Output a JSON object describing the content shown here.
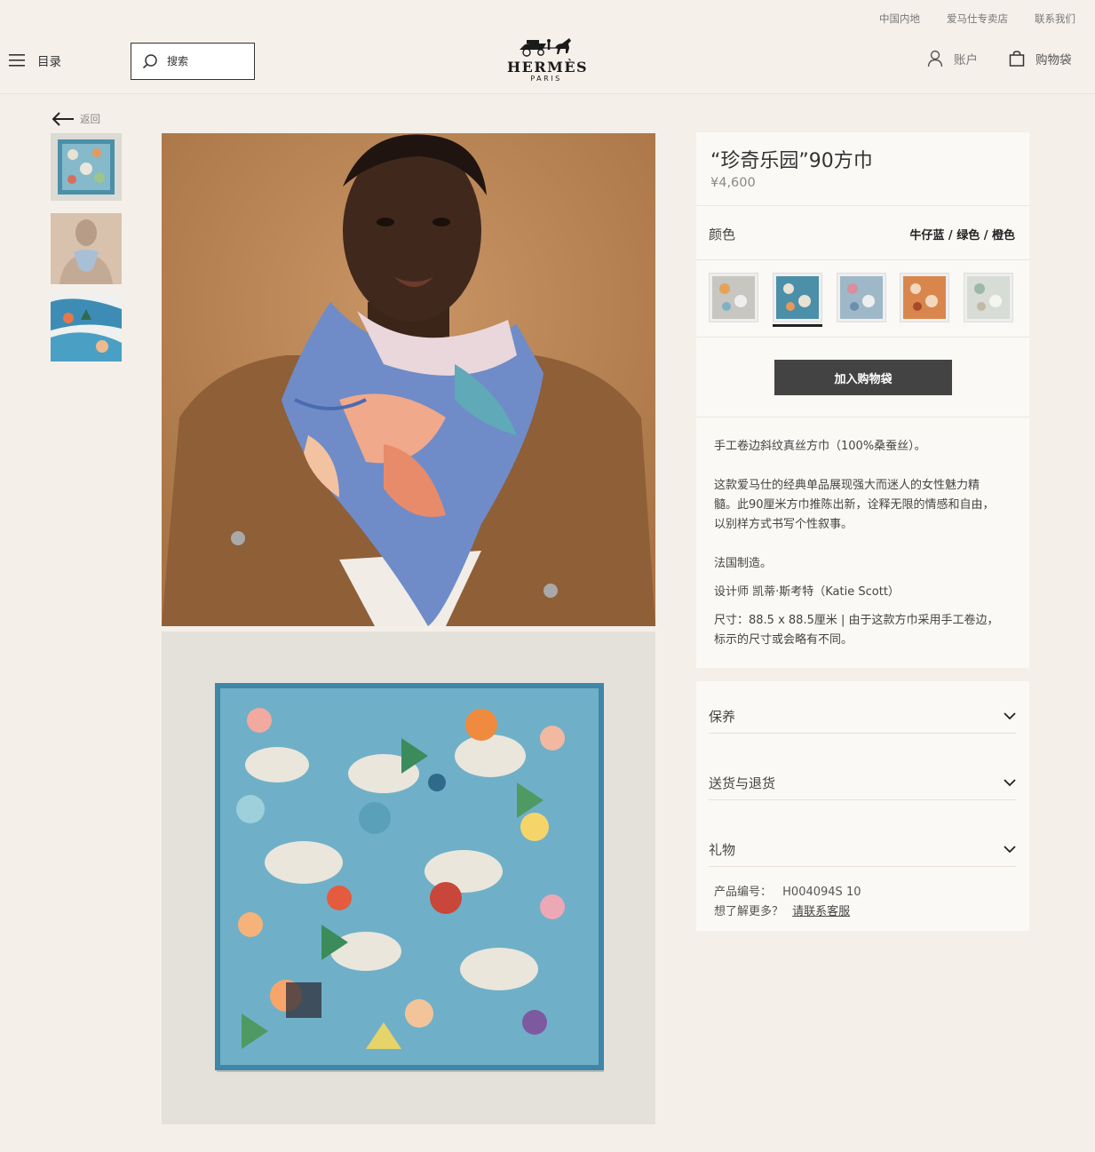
{
  "header": {
    "top_links": [
      "中国内地",
      "爱马仕专卖店",
      "联系我们"
    ],
    "menu_label": "目录",
    "search_placeholder": "搜索",
    "logo_brand": "HERMÈS",
    "logo_city": "PARIS",
    "account_label": "账户",
    "bag_label": "购物袋"
  },
  "nav": {
    "back_label": "返回"
  },
  "product": {
    "title": "“珍奇乐园”90方巾",
    "price": "¥4,600",
    "color_label": "颜色",
    "color_value": "牛仔蓝 / 绿色 / 橙色",
    "swatches": [
      {
        "name": "grey-multicolor",
        "color": "#c8c6c0",
        "accent": "#e5a35a"
      },
      {
        "name": "denim-blue",
        "color": "#4b8fa9",
        "accent": "#e8e2d5",
        "selected": true
      },
      {
        "name": "pastel-blue",
        "color": "#9fb8c8",
        "accent": "#d88fa0"
      },
      {
        "name": "orange",
        "color": "#d9864d",
        "accent": "#f2d8bf"
      },
      {
        "name": "light-grey",
        "color": "#d7dcd6",
        "accent": "#9bb8a8"
      }
    ],
    "add_to_bag": "加入购物袋",
    "description": {
      "line1": "手工卷边斜纹真丝方巾（100%桑蚕丝）。",
      "para2_1": "这款爱马仕的经典单品展现强大而迷人的女性魅力精",
      "para2_2": "髓。此90厘米方巾推陈出新，诠释无限的情感和自由，",
      "para2_3": "以别样方式书写个性叙事。",
      "made_in": "法国制造。",
      "designer": "设计师 凯蒂·斯考特（Katie Scott）",
      "size_1": "尺寸：88.5 x 88.5厘米 | 由于这款方巾采用手工卷边，",
      "size_2": "标示的尺寸或会略有不同。"
    },
    "accordions": [
      "保养",
      "送货与退货",
      "礼物"
    ],
    "sku_label": "产品编号：",
    "sku_value": "H004094S 10",
    "more_label": "想了解更多？",
    "contact_link": "请联系客服"
  },
  "colors": {
    "background": "#f4efe9",
    "panel": "#fbf9f6",
    "button": "#434343",
    "model_bg": "#c08a5c",
    "scarf_blue": "#4b8fa9"
  }
}
